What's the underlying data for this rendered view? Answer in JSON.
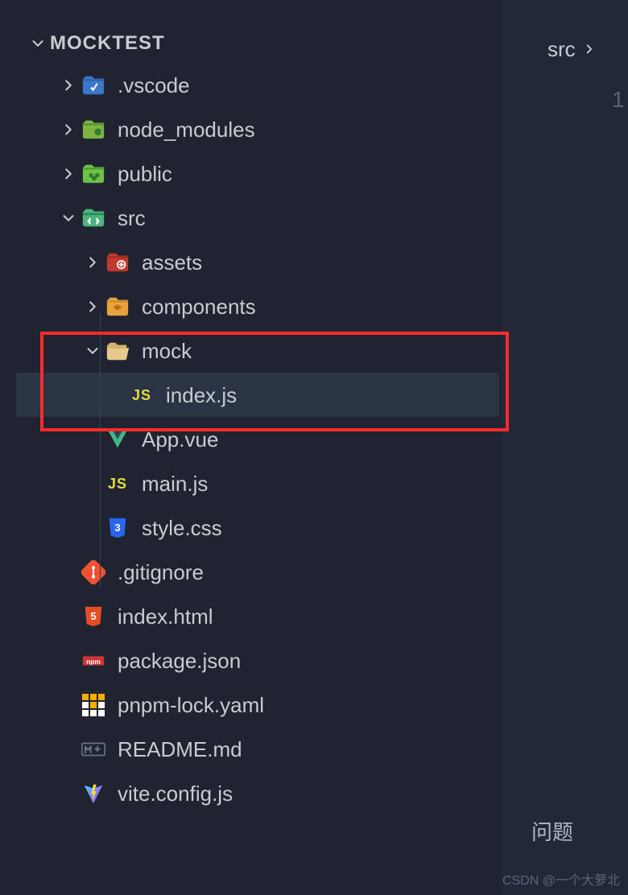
{
  "section": {
    "title": "MOCKTEST"
  },
  "tree": {
    "vscode": ".vscode",
    "node_modules": "node_modules",
    "public": "public",
    "src": "src",
    "assets": "assets",
    "components": "components",
    "mock": "mock",
    "index_js": "index.js",
    "app_vue": "App.vue",
    "main_js": "main.js",
    "style_css": "style.css",
    "gitignore": ".gitignore",
    "index_html": "index.html",
    "package_json": "package.json",
    "pnpm_lock": "pnpm-lock.yaml",
    "readme": "README.md",
    "vite_config": "vite.config.js"
  },
  "breadcrumb": {
    "src": "src"
  },
  "editor": {
    "line": "1"
  },
  "panel": {
    "problems": "问题"
  },
  "watermark": "CSDN @一个大萝北"
}
